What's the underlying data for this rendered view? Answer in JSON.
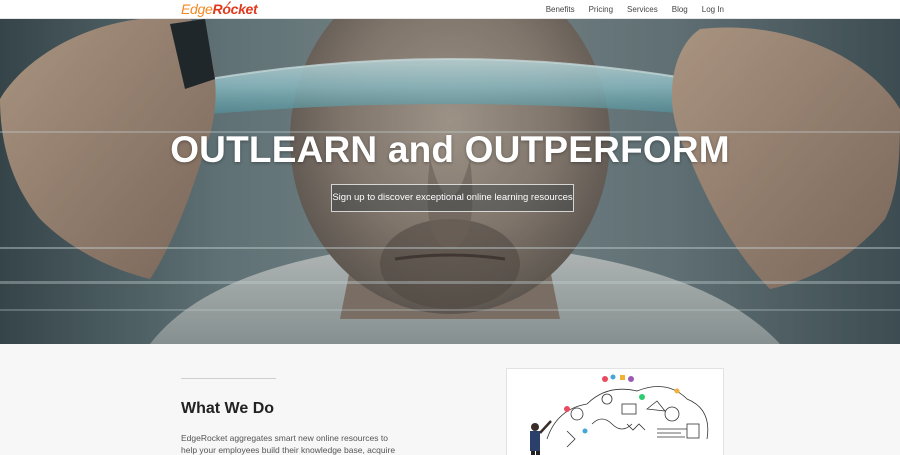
{
  "brand": {
    "logo_part1": "Edge",
    "logo_part2": "R",
    "logo_part3": "cket",
    "color_orange": "#f08a24",
    "color_red": "#e03a1e"
  },
  "nav": {
    "items": [
      {
        "label": "Benefits"
      },
      {
        "label": "Pricing"
      },
      {
        "label": "Services"
      },
      {
        "label": "Blog"
      },
      {
        "label": "Log In"
      }
    ]
  },
  "hero": {
    "title": "OUTLEARN and OUTPERFORM",
    "cta_label": "Sign up to discover exceptional online learning resources"
  },
  "what_we_do": {
    "title": "What We Do",
    "body": "EdgeRocket aggregates smart new online resources to help your employees build their knowledge base, acquire"
  }
}
